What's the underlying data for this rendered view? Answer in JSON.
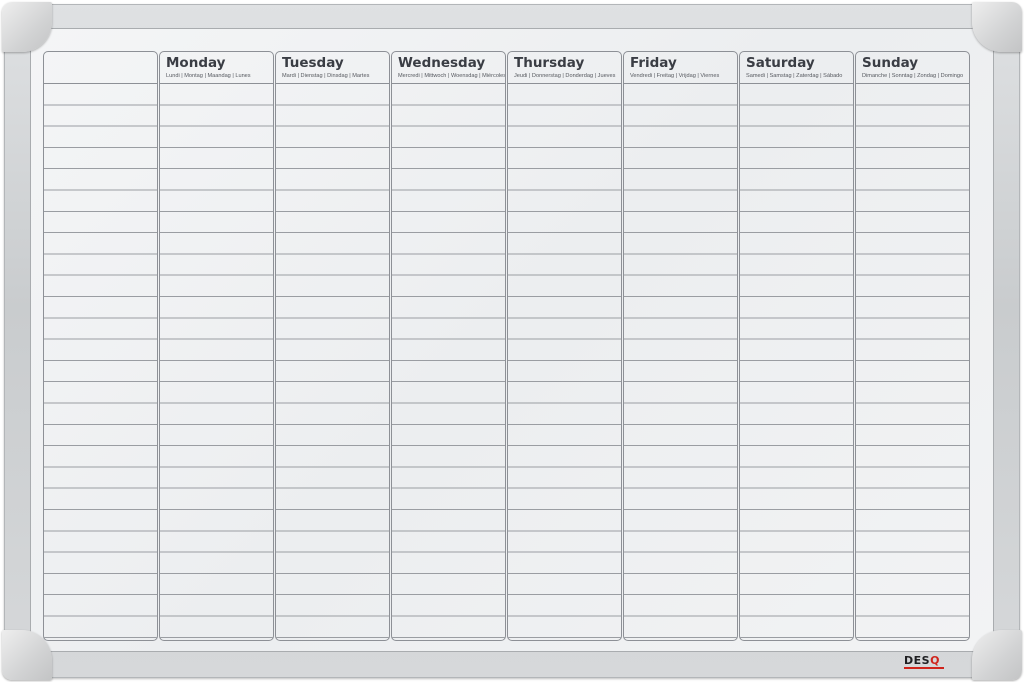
{
  "planner": {
    "columns": [
      {
        "day": "",
        "sub": ""
      },
      {
        "day": "Monday",
        "sub": "Lundi | Montag | Maandag | Lunes"
      },
      {
        "day": "Tuesday",
        "sub": "Mardi | Dienstag | Dinsdag | Martes"
      },
      {
        "day": "Wednesday",
        "sub": "Mercredi | Mittwoch | Woensdag | Miércoles"
      },
      {
        "day": "Thursday",
        "sub": "Jeudi | Donnerstag | Donderdag | Jueves"
      },
      {
        "day": "Friday",
        "sub": "Vendredi | Freitag | Vrijdag | Viernes"
      },
      {
        "day": "Saturday",
        "sub": "Samedi | Samstag | Zaterdag | Sábado"
      },
      {
        "day": "Sunday",
        "sub": "Dimanche | Sonntag | Zondag | Domingo"
      }
    ]
  },
  "brand": {
    "logo_main": "DES",
    "logo_accent": "Q",
    "accent_color": "#d0241c"
  }
}
